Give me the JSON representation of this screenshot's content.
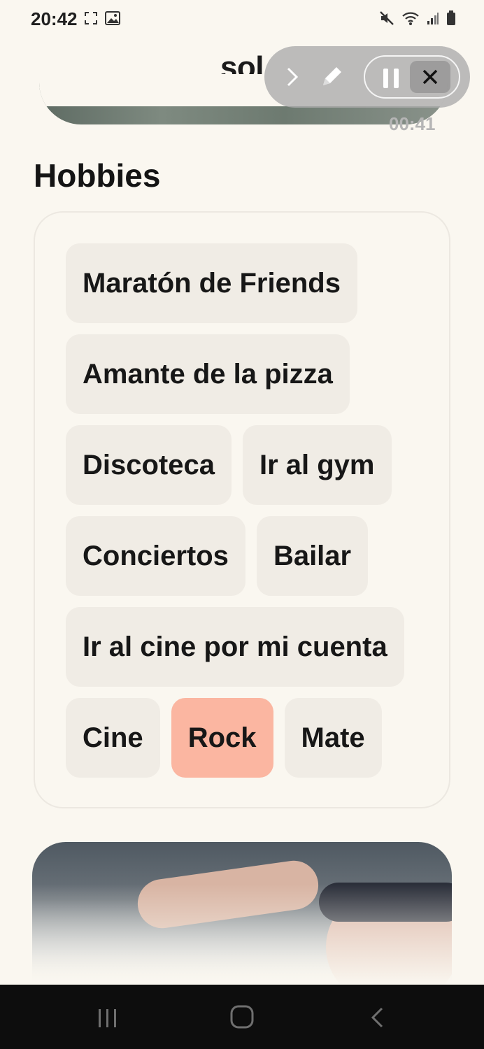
{
  "status_bar": {
    "time": "20:42",
    "left_icons": [
      "screenshot-icon",
      "gallery-icon"
    ],
    "right_icons": [
      "mute-icon",
      "wifi-icon",
      "signal-icon",
      "battery-icon"
    ]
  },
  "header": {
    "title": "sol"
  },
  "recorder": {
    "timer": "00:41",
    "controls": [
      "chevron-right-icon",
      "pen-icon",
      "pause-icon",
      "close-icon"
    ]
  },
  "hobbies": {
    "title": "Hobbies",
    "rows": [
      [
        {
          "label": "Maratón de Friends",
          "selected": false
        }
      ],
      [
        {
          "label": "Amante de la pizza",
          "selected": false
        }
      ],
      [
        {
          "label": "Discoteca",
          "selected": false
        },
        {
          "label": "Ir al gym",
          "selected": false
        }
      ],
      [
        {
          "label": "Conciertos",
          "selected": false
        },
        {
          "label": "Bailar",
          "selected": false
        }
      ],
      [
        {
          "label": "Ir al cine por mi cuenta",
          "selected": false
        }
      ],
      [
        {
          "label": "Cine",
          "selected": false
        },
        {
          "label": "Rock",
          "selected": true
        },
        {
          "label": "Mate",
          "selected": false
        }
      ]
    ]
  },
  "colors": {
    "background": "#faf7f0",
    "chip": "#f0ece5",
    "chip_selected": "#fbb6a1",
    "nav_bar": "#0d0d0d"
  },
  "nav_bar": {
    "buttons": [
      "recents-icon",
      "home-icon",
      "back-icon"
    ]
  }
}
